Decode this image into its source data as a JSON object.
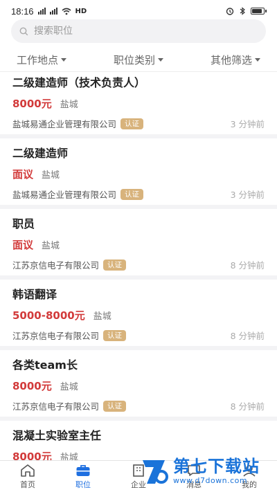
{
  "status_bar": {
    "time": "18:16",
    "network": "HD"
  },
  "search": {
    "placeholder": "搜索职位"
  },
  "filters": [
    {
      "label": "工作地点"
    },
    {
      "label": "职位类别"
    },
    {
      "label": "其他筛选"
    }
  ],
  "jobs": [
    {
      "title": "二级建造师（技术负责人）",
      "salary": "8000元",
      "city": "盐城",
      "company": "盐城易通企业管理有限公司",
      "badge": "认证",
      "time_ago": "3 分钟前"
    },
    {
      "title": "二级建造师",
      "salary": "面议",
      "city": "盐城",
      "company": "盐城易通企业管理有限公司",
      "badge": "认证",
      "time_ago": "3 分钟前"
    },
    {
      "title": "职员",
      "salary": "面议",
      "city": "盐城",
      "company": "江苏京信电子有限公司",
      "badge": "认证",
      "time_ago": "8 分钟前"
    },
    {
      "title": "韩语翻译",
      "salary": "5000-8000元",
      "city": "盐城",
      "company": "江苏京信电子有限公司",
      "badge": "认证",
      "time_ago": "8 分钟前"
    },
    {
      "title": "各类team长",
      "salary": "8000元",
      "city": "盐城",
      "company": "江苏京信电子有限公司",
      "badge": "认证",
      "time_ago": "8 分钟前"
    },
    {
      "title": "混凝土实验室主任",
      "salary": "8000元",
      "city": "盐城",
      "company": "",
      "badge": "",
      "time_ago": ""
    }
  ],
  "tabs": [
    {
      "label": "首页",
      "icon": "home-icon"
    },
    {
      "label": "职位",
      "icon": "briefcase-icon",
      "active": true
    },
    {
      "label": "企业",
      "icon": "building-icon"
    },
    {
      "label": "消息",
      "icon": "message-icon"
    },
    {
      "label": "我的",
      "icon": "user-icon"
    }
  ],
  "watermark": {
    "title": "第七下载站",
    "url": "www.d7down.com"
  },
  "colors": {
    "accent": "#1e6fe0",
    "salary": "#d23a3a",
    "badge": "#d8b37c"
  }
}
